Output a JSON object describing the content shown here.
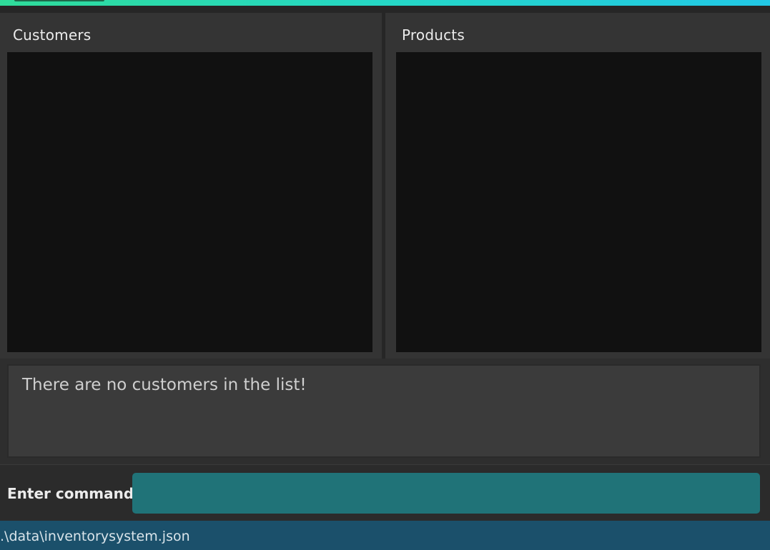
{
  "colors": {
    "accent_gradient_start": "#2fdc9a",
    "accent_gradient_end": "#22c8e6",
    "list_background": "#111111",
    "command_input": "#207378",
    "status_bar": "#1b506b"
  },
  "customers_panel": {
    "title": "Customers",
    "items": []
  },
  "products_panel": {
    "title": "Products",
    "items": []
  },
  "result_display": {
    "text": "There are no customers in the list!"
  },
  "command": {
    "label": "Enter command",
    "value": "",
    "placeholder": ""
  },
  "status_bar": {
    "file_path": ".\\data\\inventorysystem.json"
  }
}
